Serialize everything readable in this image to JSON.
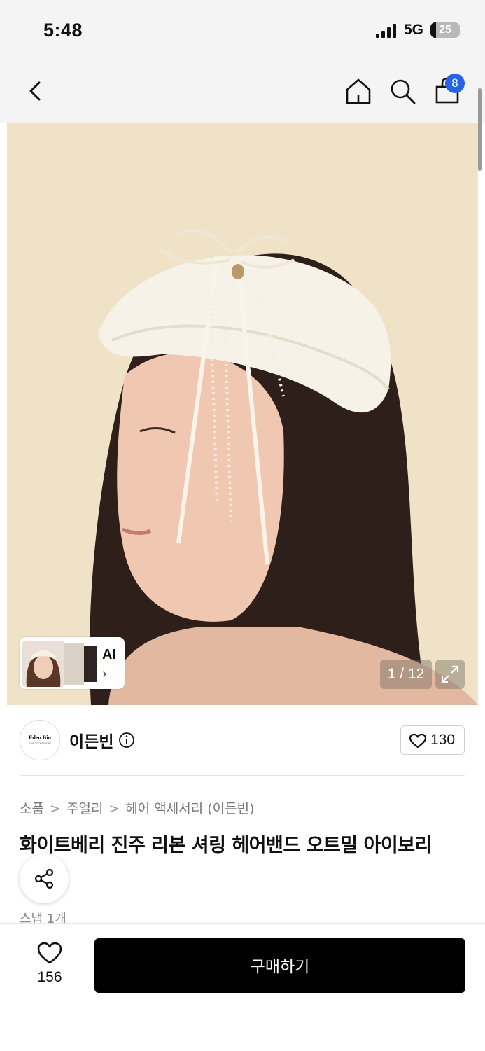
{
  "status_bar": {
    "time": "5:48",
    "network": "5G",
    "battery": "25"
  },
  "nav": {
    "cart_count": "8",
    "icons": [
      "back-arrow-icon",
      "home-icon",
      "search-icon",
      "shopping-bag-icon"
    ]
  },
  "gallery": {
    "ai_label": "AI",
    "ai_chevron": "›",
    "counter": "1 / 12"
  },
  "brand": {
    "logo_line1": "Eden Bin",
    "logo_line2": "hair accessories",
    "name": "이든빈",
    "likes": "130"
  },
  "breadcrumb": {
    "items": [
      "소품",
      "주얼리",
      "헤어 액세서리 (이든빈)"
    ],
    "separator": ">"
  },
  "product": {
    "title": "화이트베리 진주 리본 셔링 헤어밴드 오트밀 아이보리",
    "snap_count": "스냅 1개"
  },
  "bottom": {
    "likes": "156",
    "buy_label": "구매하기"
  },
  "colors": {
    "badge": "#2563eb",
    "buy_button": "#000000",
    "header_bg": "#f4f4f4"
  }
}
